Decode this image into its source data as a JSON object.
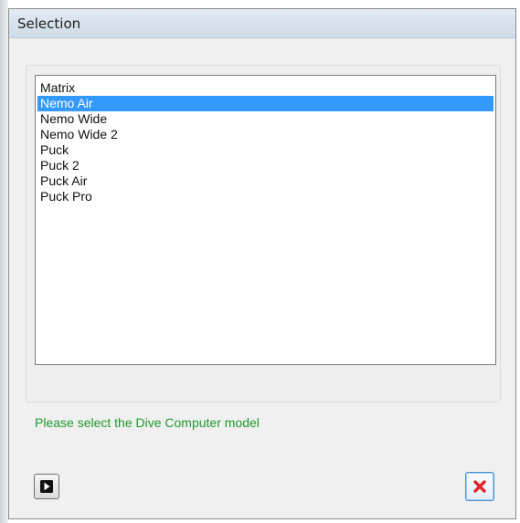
{
  "window": {
    "title": "Selection"
  },
  "list": {
    "items": [
      {
        "label": "Matrix",
        "selected": false
      },
      {
        "label": "Nemo Air",
        "selected": true
      },
      {
        "label": "Nemo Wide",
        "selected": false
      },
      {
        "label": "Nemo Wide 2",
        "selected": false
      },
      {
        "label": "Puck",
        "selected": false
      },
      {
        "label": "Puck 2",
        "selected": false
      },
      {
        "label": "Puck Air",
        "selected": false
      },
      {
        "label": "Puck Pro",
        "selected": false
      }
    ]
  },
  "hint": {
    "text": "Please select the Dive Computer model"
  },
  "buttons": {
    "next_icon": "next-arrow-icon",
    "cancel_icon": "close-icon"
  },
  "colors": {
    "selection": "#3399ff",
    "hint_text": "#1f9a2a",
    "cancel_x": "#e0262b"
  }
}
